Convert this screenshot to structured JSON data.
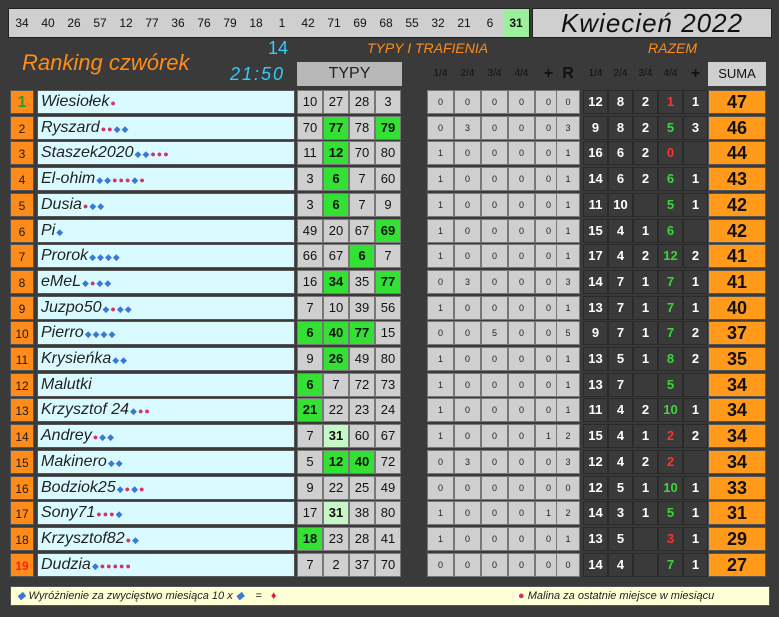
{
  "top_numbers": [
    "34",
    "40",
    "26",
    "57",
    "12",
    "77",
    "36",
    "76",
    "79",
    "18",
    "1",
    "42",
    "71",
    "69",
    "68",
    "55",
    "32",
    "21",
    "6",
    "31"
  ],
  "highlight_index": 19,
  "month": "Kwiecień 2022",
  "title": "Ranking czwórek",
  "round": "14",
  "time": "21:50",
  "headers": {
    "typy": "TYPY",
    "section_typy_trafienia": "TYPY I TRAFIENIA",
    "section_razem": "RAZEM",
    "stat_cols": [
      "1/4",
      "2/4",
      "3/4",
      "4/4",
      "+",
      "R"
    ],
    "razem_cols": [
      "1/4",
      "2/4",
      "3/4",
      "4/4",
      "+",
      "SUMA"
    ]
  },
  "rows": [
    {
      "rank": "1",
      "name": "Wiesiołek",
      "marks": "R",
      "typy": [
        "10",
        "27",
        "28",
        "3"
      ],
      "hi": [
        "",
        "",
        "",
        ""
      ],
      "stats": [
        "0",
        "0",
        "0",
        "0",
        "0",
        "0"
      ],
      "razem": [
        "12",
        "8",
        "2",
        "1",
        "1"
      ],
      "r4c": "red",
      "suma": "47"
    },
    {
      "rank": "2",
      "name": "Ryszard",
      "marks": "RRDD",
      "typy": [
        "70",
        "77",
        "78",
        "79"
      ],
      "hi": [
        "",
        "g",
        "",
        "g"
      ],
      "stats": [
        "0",
        "3",
        "0",
        "0",
        "0",
        "3"
      ],
      "razem": [
        "9",
        "8",
        "2",
        "5",
        "3"
      ],
      "r4c": "g",
      "suma": "46"
    },
    {
      "rank": "3",
      "name": "Staszek2020",
      "marks": "DDRRR",
      "typy": [
        "11",
        "12",
        "70",
        "80"
      ],
      "hi": [
        "",
        "g",
        "",
        ""
      ],
      "stats": [
        "1",
        "0",
        "0",
        "0",
        "0",
        "1"
      ],
      "razem": [
        "16",
        "6",
        "2",
        "0",
        ""
      ],
      "r4c": "red",
      "suma": "44"
    },
    {
      "rank": "4",
      "name": "El-ohim",
      "marks": "DDRRRDR",
      "typy": [
        "3",
        "6",
        "7",
        "60"
      ],
      "hi": [
        "",
        "g",
        "",
        ""
      ],
      "stats": [
        "1",
        "0",
        "0",
        "0",
        "0",
        "1"
      ],
      "razem": [
        "14",
        "6",
        "2",
        "6",
        "1"
      ],
      "r4c": "g",
      "suma": "43"
    },
    {
      "rank": "5",
      "name": "Dusia",
      "marks": "RDD",
      "typy": [
        "3",
        "6",
        "7",
        "9"
      ],
      "hi": [
        "",
        "g",
        "",
        ""
      ],
      "stats": [
        "1",
        "0",
        "0",
        "0",
        "0",
        "1"
      ],
      "razem": [
        "11",
        "10",
        "",
        "5",
        "1"
      ],
      "r4c": "g",
      "suma": "42"
    },
    {
      "rank": "6",
      "name": "Pi",
      "marks": "D",
      "typy": [
        "49",
        "20",
        "67",
        "69"
      ],
      "hi": [
        "",
        "",
        "",
        "g"
      ],
      "stats": [
        "1",
        "0",
        "0",
        "0",
        "0",
        "1"
      ],
      "razem": [
        "15",
        "4",
        "1",
        "6",
        ""
      ],
      "r4c": "g",
      "suma": "42"
    },
    {
      "rank": "7",
      "name": "Prorok",
      "marks": "DDDD",
      "typy": [
        "66",
        "67",
        "6",
        "7"
      ],
      "hi": [
        "",
        "",
        "g",
        ""
      ],
      "stats": [
        "1",
        "0",
        "0",
        "0",
        "0",
        "1"
      ],
      "razem": [
        "17",
        "4",
        "2",
        "12",
        "2"
      ],
      "r4c": "g",
      "suma": "41"
    },
    {
      "rank": "8",
      "name": "eMeL",
      "marks": "DRDD",
      "typy": [
        "16",
        "34",
        "35",
        "77"
      ],
      "hi": [
        "",
        "g",
        "",
        "g"
      ],
      "stats": [
        "0",
        "3",
        "0",
        "0",
        "0",
        "3"
      ],
      "razem": [
        "14",
        "7",
        "1",
        "7",
        "1"
      ],
      "r4c": "g",
      "suma": "41"
    },
    {
      "rank": "9",
      "name": "Juzpo50",
      "marks": "DRDD",
      "typy": [
        "7",
        "10",
        "39",
        "56"
      ],
      "hi": [
        "",
        "",
        "",
        ""
      ],
      "stats": [
        "1",
        "0",
        "0",
        "0",
        "0",
        "1"
      ],
      "razem": [
        "13",
        "7",
        "1",
        "7",
        "1"
      ],
      "r4c": "g",
      "suma": "40"
    },
    {
      "rank": "10",
      "name": "Pierro",
      "marks": "DDDD",
      "typy": [
        "6",
        "40",
        "77",
        "15"
      ],
      "hi": [
        "g",
        "g",
        "g",
        ""
      ],
      "stats": [
        "0",
        "0",
        "5",
        "0",
        "0",
        "5"
      ],
      "razem": [
        "9",
        "7",
        "1",
        "7",
        "2"
      ],
      "r4c": "g",
      "suma": "37"
    },
    {
      "rank": "11",
      "name": "Krysieńka",
      "marks": "DD",
      "typy": [
        "9",
        "26",
        "49",
        "80"
      ],
      "hi": [
        "",
        "g",
        "",
        ""
      ],
      "stats": [
        "1",
        "0",
        "0",
        "0",
        "0",
        "1"
      ],
      "razem": [
        "13",
        "5",
        "1",
        "8",
        "2"
      ],
      "r4c": "g",
      "suma": "35"
    },
    {
      "rank": "12",
      "name": "Malutki",
      "marks": "",
      "typy": [
        "6",
        "7",
        "72",
        "73"
      ],
      "hi": [
        "g",
        "",
        "",
        ""
      ],
      "stats": [
        "1",
        "0",
        "0",
        "0",
        "0",
        "1"
      ],
      "razem": [
        "13",
        "7",
        "",
        "5",
        ""
      ],
      "r4c": "g",
      "suma": "34"
    },
    {
      "rank": "13",
      "name": "Krzysztof 24",
      "marks": "DRR",
      "typy": [
        "21",
        "22",
        "23",
        "24"
      ],
      "hi": [
        "g",
        "",
        "",
        ""
      ],
      "stats": [
        "1",
        "0",
        "0",
        "0",
        "0",
        "1"
      ],
      "razem": [
        "11",
        "4",
        "2",
        "10",
        "1"
      ],
      "r4c": "g",
      "suma": "34"
    },
    {
      "rank": "14",
      "name": "Andrey",
      "marks": "RDD",
      "typy": [
        "7",
        "31",
        "60",
        "67"
      ],
      "hi": [
        "",
        "lg",
        "",
        ""
      ],
      "stats": [
        "1",
        "0",
        "0",
        "0",
        "1",
        "2"
      ],
      "razem": [
        "15",
        "4",
        "1",
        "2",
        "2"
      ],
      "r4c": "red",
      "suma": "34"
    },
    {
      "rank": "15",
      "name": "Makinero",
      "marks": "DD",
      "typy": [
        "5",
        "12",
        "40",
        "72"
      ],
      "hi": [
        "",
        "g",
        "g",
        ""
      ],
      "stats": [
        "0",
        "3",
        "0",
        "0",
        "0",
        "3"
      ],
      "razem": [
        "12",
        "4",
        "2",
        "2",
        ""
      ],
      "r4c": "red",
      "suma": "34"
    },
    {
      "rank": "16",
      "name": "Bodziok25",
      "marks": "DRDR",
      "typy": [
        "9",
        "22",
        "25",
        "49"
      ],
      "hi": [
        "",
        "",
        "",
        ""
      ],
      "stats": [
        "0",
        "0",
        "0",
        "0",
        "0",
        "0"
      ],
      "razem": [
        "12",
        "5",
        "1",
        "10",
        "1"
      ],
      "r4c": "g",
      "suma": "33"
    },
    {
      "rank": "17",
      "name": "Sony71",
      "marks": "RRRD",
      "typy": [
        "17",
        "31",
        "38",
        "80"
      ],
      "hi": [
        "",
        "lg",
        "",
        ""
      ],
      "stats": [
        "1",
        "0",
        "0",
        "0",
        "1",
        "2"
      ],
      "razem": [
        "14",
        "3",
        "1",
        "5",
        "1"
      ],
      "r4c": "g",
      "suma": "31"
    },
    {
      "rank": "18",
      "name": "Krzysztof82",
      "marks": "RD",
      "typy": [
        "18",
        "23",
        "28",
        "41"
      ],
      "hi": [
        "g",
        "",
        "",
        ""
      ],
      "stats": [
        "1",
        "0",
        "0",
        "0",
        "0",
        "1"
      ],
      "razem": [
        "13",
        "5",
        "",
        "3",
        "1"
      ],
      "r4c": "red",
      "suma": "29"
    },
    {
      "rank": "19",
      "name": "Dudzia",
      "marks": "DRRRRR",
      "typy": [
        "7",
        "2",
        "37",
        "70"
      ],
      "hi": [
        "",
        "",
        "",
        ""
      ],
      "stats": [
        "0",
        "0",
        "0",
        "0",
        "0",
        "0"
      ],
      "razem": [
        "14",
        "4",
        "",
        "7",
        "1"
      ],
      "r4c": "g",
      "suma": "27"
    }
  ],
  "footer": {
    "left": "Wyróżnienie za zwycięstwo miesiąca  10 x",
    "eq": "=",
    "right": "Malina za ostatnie miejsce w miesiącu"
  },
  "icons": {
    "rank_mark": "raspberry-icon",
    "diamond_mark": "diamond-icon",
    "gem": "gem-icon"
  },
  "colors": {
    "orange": "#ff8c1a",
    "green": "#33e033",
    "cyan": "#33ccff",
    "red": "#ff3030"
  }
}
